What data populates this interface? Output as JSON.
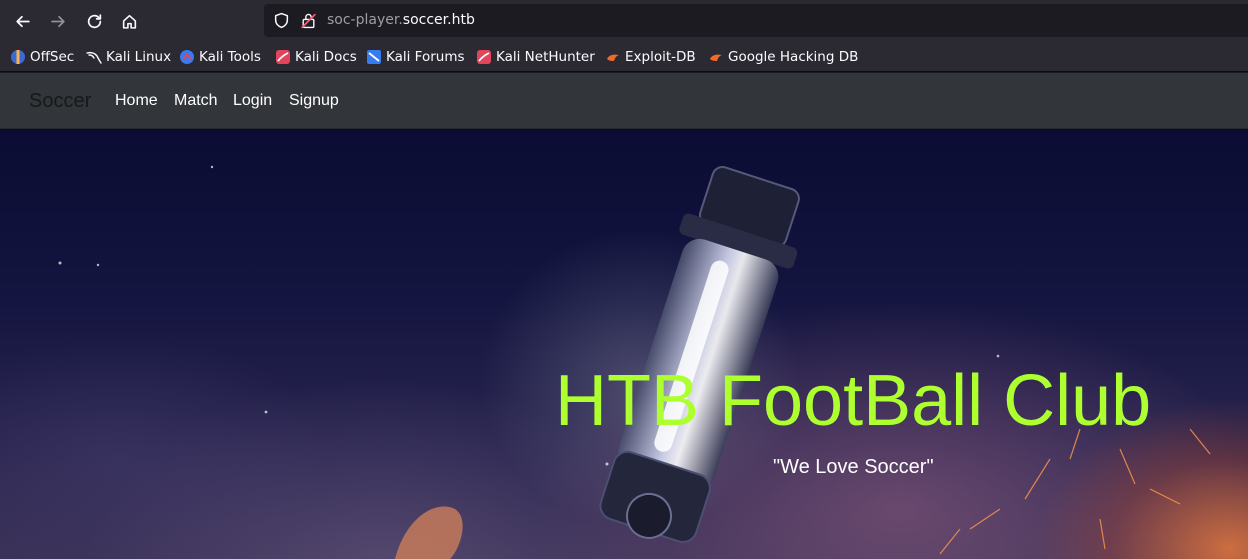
{
  "browser": {
    "url_subdomain": "soc-player.",
    "url_domain": "soccer.htb"
  },
  "bookmarks": [
    {
      "label": "OffSec",
      "icon": "offsec-icon"
    },
    {
      "label": "Kali Linux",
      "icon": "kali-dragon-icon"
    },
    {
      "label": "Kali Tools",
      "icon": "kali-tools-icon"
    },
    {
      "label": "Kali Docs",
      "icon": "kali-docs-icon"
    },
    {
      "label": "Kali Forums",
      "icon": "kali-forums-icon"
    },
    {
      "label": "Kali NetHunter",
      "icon": "kali-nethunter-icon"
    },
    {
      "label": "Exploit-DB",
      "icon": "exploit-db-icon"
    },
    {
      "label": "Google Hacking DB",
      "icon": "ghdb-icon"
    }
  ],
  "site": {
    "brand": "Soccer",
    "nav": [
      "Home",
      "Match",
      "Login",
      "Signup"
    ]
  },
  "hero": {
    "title": "HTB FootBall Club",
    "subtitle": "\"We Love Soccer\""
  },
  "colors": {
    "title": "#adff2f",
    "navbar": "#323539",
    "toolbar": "#2b2a33"
  }
}
